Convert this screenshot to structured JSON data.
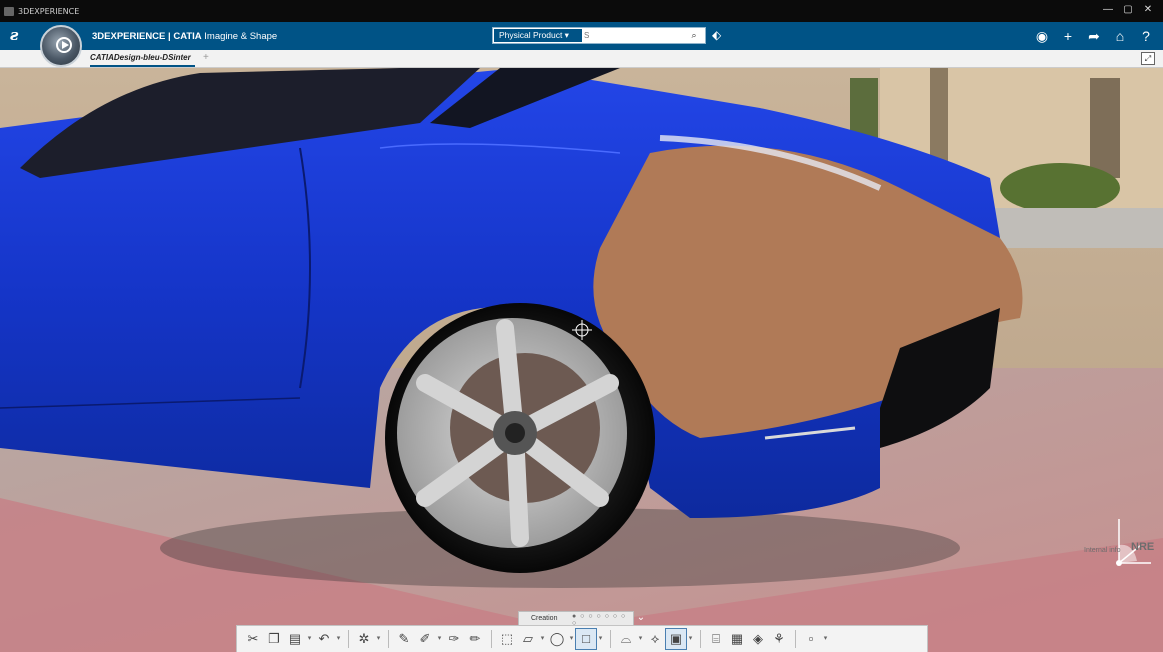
{
  "os_bar": {
    "title": "3DEXPERIENCE",
    "buttons": [
      "—",
      "▢",
      "✕"
    ]
  },
  "top_bar": {
    "brand_prefix": "3DEXPERIENCE | ",
    "brand_strong": "CATIA",
    "brand_suffix": " Imagine & Shape",
    "search_scope": "Physical Product ▾",
    "search_placeholder": "S",
    "search_icon": "search-icon",
    "right_icons": [
      "user-icon",
      "plus-icon",
      "share-icon",
      "home-icon",
      "help-icon"
    ]
  },
  "tab_bar": {
    "active_tab": "CATIADesign-bleu-DSinter",
    "add": "+"
  },
  "viewport": {
    "watermark_small": "Internal info",
    "watermark_large": "NRE"
  },
  "section": {
    "label": "Creation",
    "dots": "● ○ ○ ○ ○ ○ ○ ○",
    "chevron": "⌄"
  },
  "toolbar": {
    "groups": [
      [
        "cut-icon",
        "copy-icon",
        "paste-icon",
        "undo-icon"
      ],
      [
        "recycle-icon"
      ],
      [
        "pen-icon",
        "brush-icon",
        "curve-icon",
        "pencil-icon"
      ],
      [
        "box-icon",
        "plane-icon",
        "sphere-icon",
        "square-icon"
      ],
      [
        "surface-icon",
        "grid-icon",
        "patch-icon"
      ],
      [
        "wire-icon",
        "mesh-icon",
        "shell-icon",
        "link-icon"
      ],
      [
        "point-icon"
      ]
    ]
  },
  "colors": {
    "brand_blue": "#005386",
    "car_blue": "#1638d8",
    "patch_copper": "#b07a57"
  }
}
